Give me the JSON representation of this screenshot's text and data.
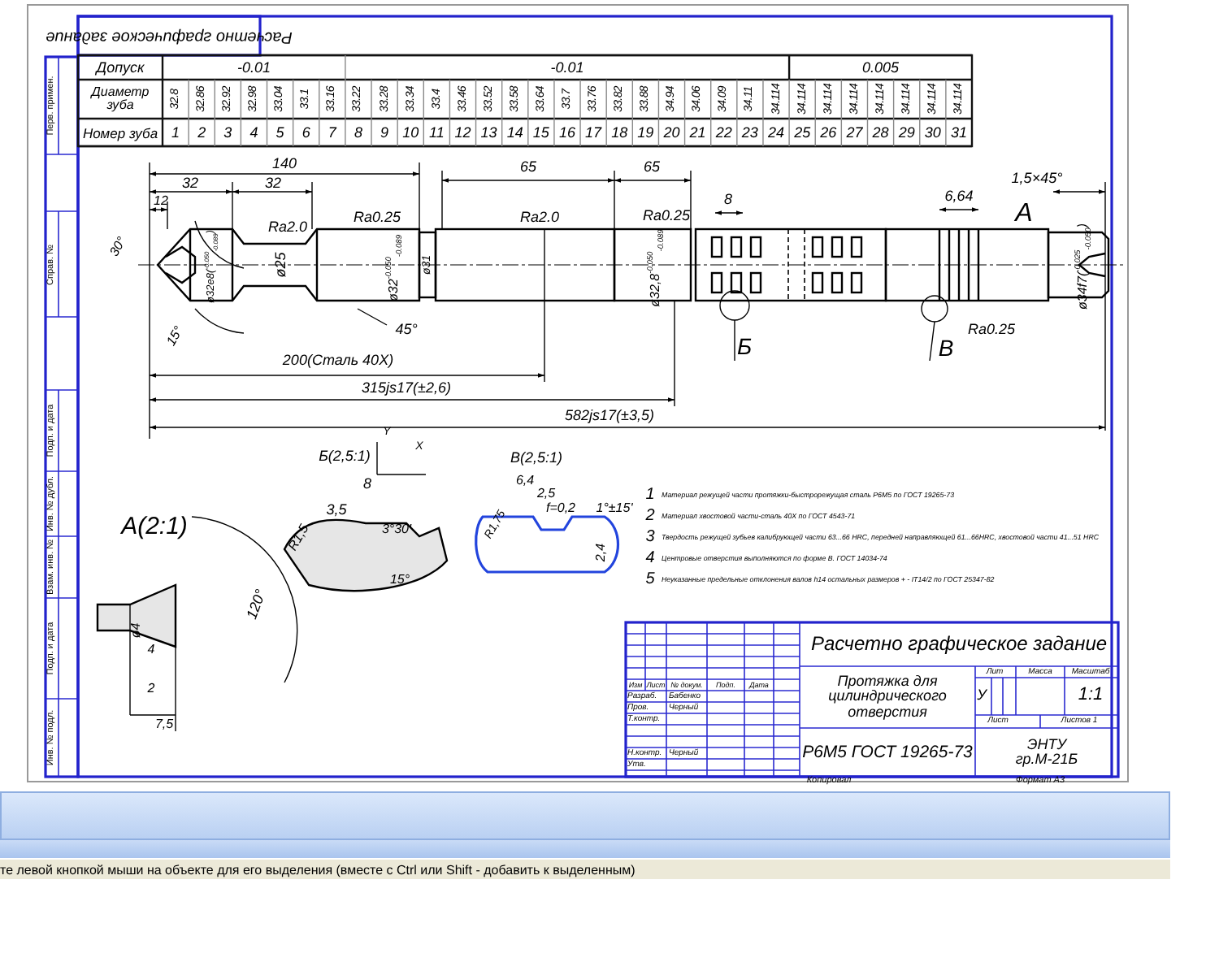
{
  "sheet": {
    "side_stamps": [
      "Перв. примен.",
      "Справ. №",
      "Подп. и дата",
      "Инв. № дубл.",
      "Взам. инв. №",
      "Подп. и дата",
      "Инв. № подл."
    ],
    "mirrored_title": "Расчетно графическое задание",
    "teeth_table": {
      "tolerance_label": "Допуск",
      "diameter_label": "Диаметр зуба",
      "number_label": "Номер зуба",
      "tolerance_groups": [
        {
          "value": "-0.01"
        },
        {
          "value": "-0.01"
        },
        {
          "value": "0.005"
        }
      ],
      "teeth": [
        {
          "number": "1",
          "diameter": "32.8"
        },
        {
          "number": "2",
          "diameter": "32.86"
        },
        {
          "number": "3",
          "diameter": "32.92"
        },
        {
          "number": "4",
          "diameter": "32.98"
        },
        {
          "number": "5",
          "diameter": "33.04"
        },
        {
          "number": "6",
          "diameter": "33.1"
        },
        {
          "number": "7",
          "diameter": "33.16"
        },
        {
          "number": "8",
          "diameter": "33.22"
        },
        {
          "number": "9",
          "diameter": "33.28"
        },
        {
          "number": "10",
          "diameter": "33.34"
        },
        {
          "number": "11",
          "diameter": "33.4"
        },
        {
          "number": "12",
          "diameter": "33.46"
        },
        {
          "number": "13",
          "diameter": "33.52"
        },
        {
          "number": "14",
          "diameter": "33.58"
        },
        {
          "number": "15",
          "diameter": "33.64"
        },
        {
          "number": "16",
          "diameter": "33.7"
        },
        {
          "number": "17",
          "diameter": "33.76"
        },
        {
          "number": "18",
          "diameter": "33.82"
        },
        {
          "number": "19",
          "diameter": "33.88"
        },
        {
          "number": "20",
          "diameter": "34.94"
        },
        {
          "number": "21",
          "diameter": "34.06"
        },
        {
          "number": "22",
          "diameter": "34.09"
        },
        {
          "number": "23",
          "diameter": "34.11"
        },
        {
          "number": "24",
          "diameter": "34.114"
        },
        {
          "number": "25",
          "diameter": "34.114"
        },
        {
          "number": "26",
          "diameter": "34.114"
        },
        {
          "number": "27",
          "diameter": "34.114"
        },
        {
          "number": "28",
          "diameter": "34.114"
        },
        {
          "number": "29",
          "diameter": "34.114"
        },
        {
          "number": "30",
          "diameter": "34.114"
        },
        {
          "number": "31",
          "diameter": "34.114"
        }
      ]
    },
    "drawing_labels": [
      "140",
      "32",
      "32",
      "12",
      "65",
      "65",
      "8",
      "6,64",
      "1,5×45°",
      "А",
      "Ra2.0",
      "Ra0.25",
      "Ra2.0",
      "Ra0.25",
      "Ra0.25",
      "30°",
      "ø32e8($^{-0.050}$$_{-0.089}$)",
      "ø25",
      "ø32$^{-0.050}$$_{-0.089}$",
      "ø31",
      "ø32,8$^{-0.050}$$_{-0.089}$",
      "ø34f7($^{-0.025}$$_{-0.050}$)",
      "45°",
      "15°",
      "Б",
      "В",
      "200(Сталь 40Х)",
      "315js17(±2,6)",
      "582js17(±3,5)",
      "Y",
      "X",
      "Б(2,5:1)",
      "В(2,5:1)",
      "8",
      "6,4",
      "2,5",
      "3,5",
      "А(2:1)",
      "R1,5",
      "3°30'",
      "R1,75",
      "f=0,2",
      "1°±15'",
      "2,4",
      "15°",
      "ø4",
      "4",
      "120°",
      "2",
      "7,5"
    ],
    "notes": [
      {
        "number": "1",
        "text": "Материал режущей части протяжки-быстрорежущая сталь Р6М5 по ГОСТ 19265-73"
      },
      {
        "number": "2",
        "text": "Материал хвостовой части-сталь 40Х по ГОСТ 4543-71"
      },
      {
        "number": "3",
        "text": "Твердость режущей зубьев калибрующей части 63...66 HRC, передней направляющей 61...66HRC, хвостовой части 41...51 HRC"
      },
      {
        "number": "4",
        "text": "Центровые отверстия выполняются по форме В. ГОСТ 14034-74"
      },
      {
        "number": "5",
        "text": "Неуказанные предельные отклонения валов h14 остальных размеров + - IT14/2 по ГОСТ 25347-82"
      }
    ],
    "title_block": {
      "headers": [
        "Изм",
        "Лист",
        "№ докум.",
        "Подп.",
        "Дата"
      ],
      "roles": [
        {
          "role": "Разраб.",
          "name": "Бабенко"
        },
        {
          "role": "Пров.",
          "name": "Черный"
        },
        {
          "role": "Т.контр."
        },
        {
          "role": "Н.контр.",
          "name": "Черный"
        },
        {
          "role": "Утв."
        }
      ],
      "work_title": "Расчетно графическое задание",
      "part_name": "Протяжка для цилиндрического отверстия",
      "lit_label": "Лит",
      "mass_label": "Масса",
      "scale_label": "Масштаб",
      "lit_value": "У",
      "scale_value": "1:1",
      "sheet_label": "Лист",
      "sheets_label": "Листов 1",
      "material": "Р6М5 ГОСТ 19265-73",
      "organization": "ЭНТУ гр.М-21Б",
      "copied_label": "Копировал",
      "format_label": "Формат А3"
    }
  },
  "status_bar": {
    "text": "те левой кнопкой мыши на объекте для его выделения (вместе с Ctrl или Shift - добавить к выделенным)"
  }
}
